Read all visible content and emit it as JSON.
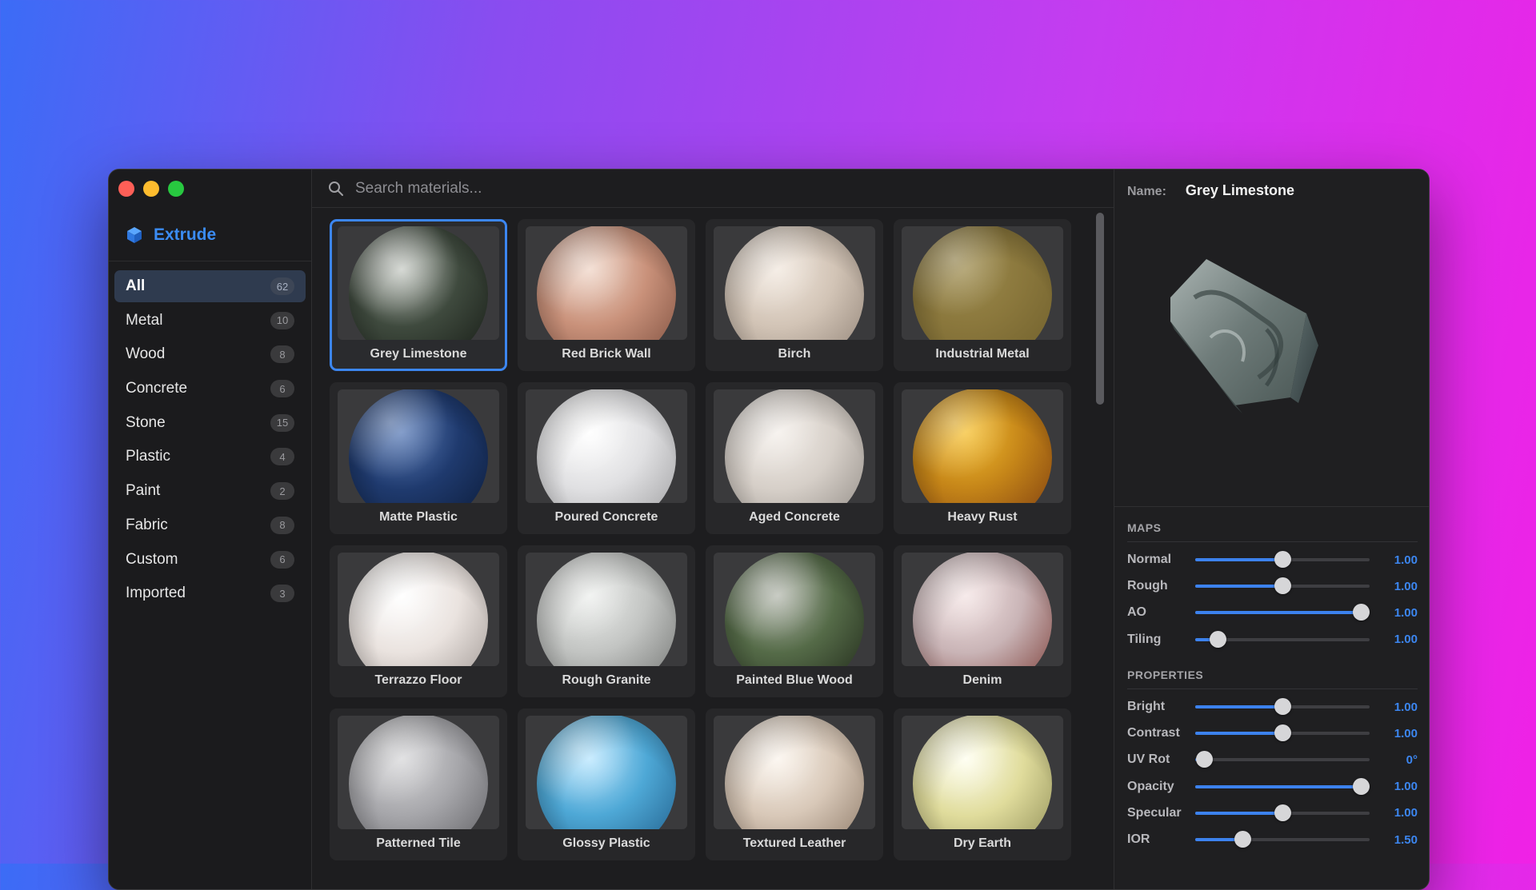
{
  "app": {
    "name": "Extrude"
  },
  "search": {
    "placeholder": "Search materials..."
  },
  "categories": [
    {
      "label": "All",
      "count": "62",
      "active": true
    },
    {
      "label": "Metal",
      "count": "10"
    },
    {
      "label": "Wood",
      "count": "8"
    },
    {
      "label": "Concrete",
      "count": "6"
    },
    {
      "label": "Stone",
      "count": "15"
    },
    {
      "label": "Plastic",
      "count": "4"
    },
    {
      "label": "Paint",
      "count": "2"
    },
    {
      "label": "Fabric",
      "count": "8"
    },
    {
      "label": "Custom",
      "count": "6"
    },
    {
      "label": "Imported",
      "count": "3"
    }
  ],
  "materials": [
    {
      "label": "Grey Limestone",
      "selected": true,
      "colors": [
        "#c9cdc7",
        "#3f4a3e",
        "#151a14"
      ]
    },
    {
      "label": "Red Brick Wall",
      "colors": [
        "#f0d6c8",
        "#c9917a",
        "#7a4c3c"
      ]
    },
    {
      "label": "Birch",
      "colors": [
        "#f2e8de",
        "#d2c4b6",
        "#8e8074"
      ]
    },
    {
      "label": "Industrial Metal",
      "colors": [
        "#9c8a4c",
        "#8a773c",
        "#6f5f2c"
      ]
    },
    {
      "label": "Matte Plastic",
      "colors": [
        "#5a7cb8",
        "#1f3a6e",
        "#0b1a36"
      ]
    },
    {
      "label": "Poured Concrete",
      "colors": [
        "#ffffff",
        "#e0e0e2",
        "#9a9a9c"
      ]
    },
    {
      "label": "Aged Concrete",
      "colors": [
        "#f4efea",
        "#d6cfc8",
        "#8e8882"
      ]
    },
    {
      "label": "Heavy Rust",
      "colors": [
        "#f6c030",
        "#c48418",
        "#7a3a10"
      ]
    },
    {
      "label": "Terrazzo Floor",
      "colors": [
        "#ffffff",
        "#eae3df",
        "#9c9490"
      ]
    },
    {
      "label": "Rough Granite",
      "colors": [
        "#eef0ee",
        "#c2c4c2",
        "#707270"
      ]
    },
    {
      "label": "Painted Blue Wood",
      "colors": [
        "#b6bab0",
        "#556b48",
        "#1e2618"
      ]
    },
    {
      "label": "Denim",
      "colors": [
        "#f4e4e4",
        "#c9b4b6",
        "#7a3a34"
      ]
    },
    {
      "label": "Patterned Tile",
      "colors": [
        "#d8d8da",
        "#a6a6aa",
        "#5c5c60"
      ]
    },
    {
      "label": "Glossy Plastic",
      "colors": [
        "#b8e6ff",
        "#4ea8d6",
        "#1e5a86"
      ]
    },
    {
      "label": "Textured Leather",
      "colors": [
        "#fbf4ec",
        "#d8c8b8",
        "#8a7664"
      ]
    },
    {
      "label": "Dry Earth",
      "colors": [
        "#ffffee",
        "#e0dc9c",
        "#8c8a54"
      ]
    }
  ],
  "panel": {
    "name_label": "Name:",
    "name_value": "Grey Limestone",
    "maps_title": "MAPS",
    "maps": [
      {
        "label": "Normal",
        "value": "1.00",
        "level": 0.5
      },
      {
        "label": "Rough",
        "value": "1.00",
        "level": 0.5
      },
      {
        "label": "AO",
        "value": "1.00",
        "level": 0.95
      },
      {
        "label": "Tiling",
        "value": "1.00",
        "level": 0.13
      }
    ],
    "properties_title": "PROPERTIES",
    "properties": [
      {
        "label": "Bright",
        "value": "1.00",
        "level": 0.5
      },
      {
        "label": "Contrast",
        "value": "1.00",
        "level": 0.5
      },
      {
        "label": "UV Rot",
        "value": "0°",
        "level": 0.05
      },
      {
        "label": "Opacity",
        "value": "1.00",
        "level": 0.95
      },
      {
        "label": "Specular",
        "value": "1.00",
        "level": 0.5
      },
      {
        "label": "IOR",
        "value": "1.50",
        "level": 0.27
      }
    ]
  }
}
